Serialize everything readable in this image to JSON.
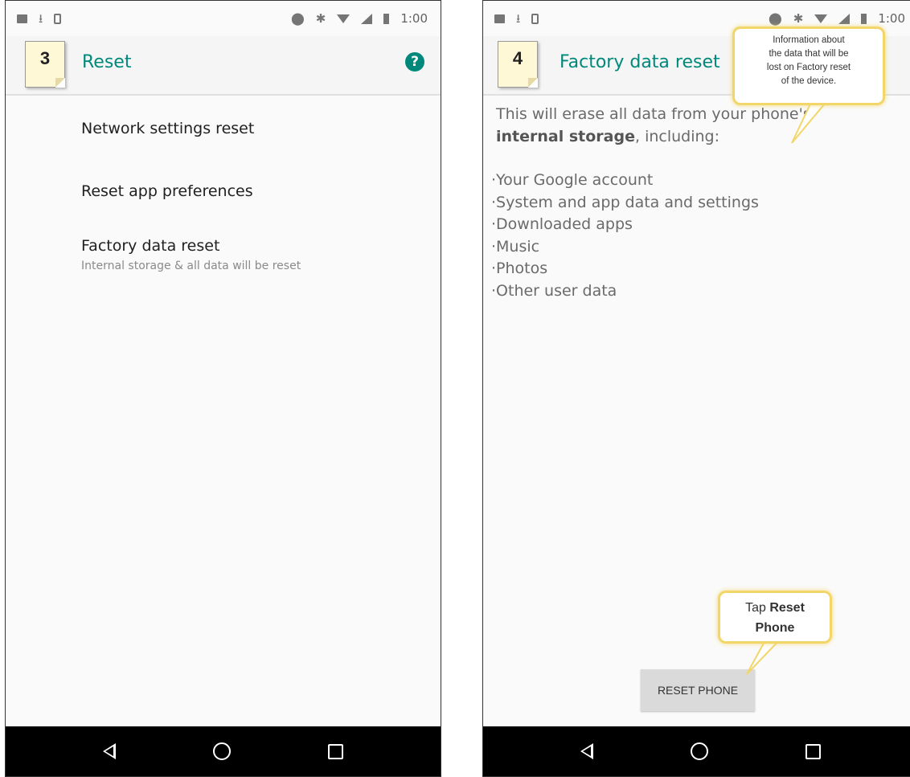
{
  "left_screen": {
    "status": {
      "time": "1:00"
    },
    "step_number": "3",
    "title": "Reset",
    "help_icon": "help-circle-icon",
    "items": [
      {
        "title": "Network settings reset",
        "subtitle": ""
      },
      {
        "title": "Reset app preferences",
        "subtitle": ""
      },
      {
        "title": "Factory data reset",
        "subtitle": "Internal storage & all data will be reset"
      }
    ]
  },
  "right_screen": {
    "status": {
      "time": "1:00"
    },
    "step_number": "4",
    "title": "Factory data reset",
    "intro_text": "This will erase all data from your phone's",
    "intro_bold": "internal storage",
    "intro_tail": ", including:",
    "bullets": [
      "·Your Google account",
      "·System and app data and settings",
      "·Downloaded apps",
      "·Music",
      "·Photos",
      "·Other user data"
    ],
    "reset_button": "RESET PHONE",
    "callout_info": [
      "Information about",
      "the data that will be",
      "lost on Factory reset",
      "of the device."
    ],
    "callout_tap_prefix": "Tap ",
    "callout_tap_bold1": "Reset",
    "callout_tap_bold2": "Phone"
  },
  "colors": {
    "accent": "#00897b",
    "callout_border": "#f2d66a",
    "note": "#fff8d6"
  }
}
